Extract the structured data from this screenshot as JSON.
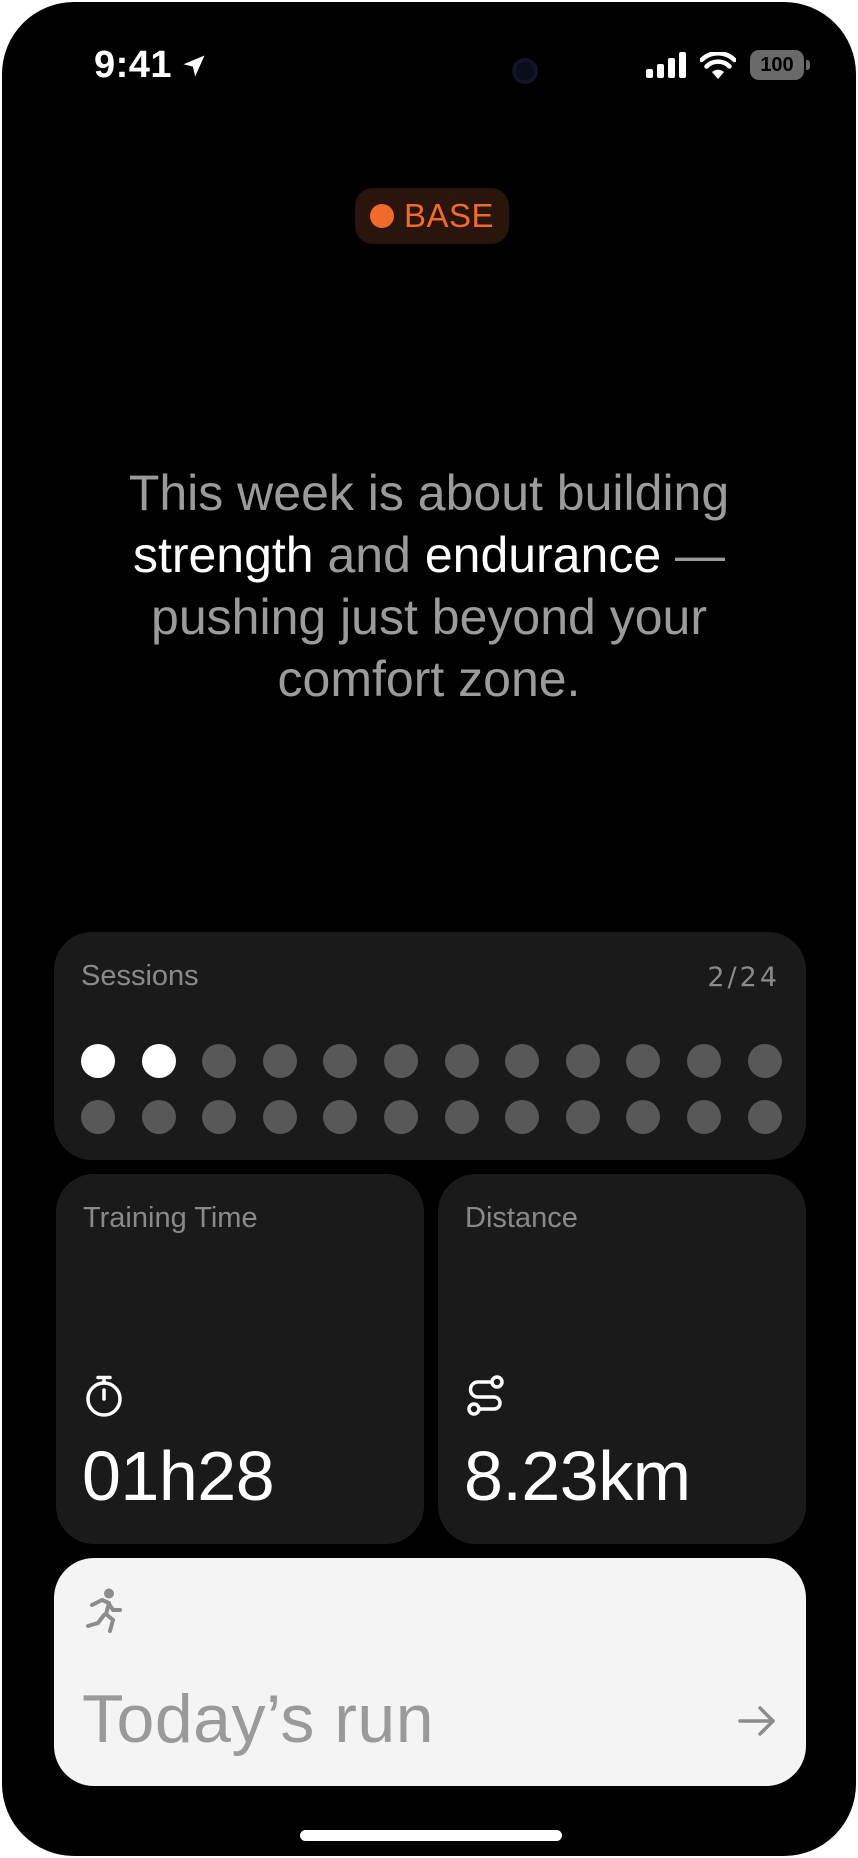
{
  "status_bar": {
    "time": "9:41",
    "battery": "100",
    "icons": [
      "location-arrow-icon",
      "signal-icon",
      "wifi-icon",
      "battery-icon"
    ]
  },
  "phase": {
    "label": "BASE",
    "color": "#f06a2b"
  },
  "headline": {
    "part1": "This week is about building ",
    "highlight1": "strength",
    "part2": " and ",
    "highlight2": "endurance",
    "part3": " —pushing just beyond your comfort zone."
  },
  "sessions": {
    "title": "Sessions",
    "count": "2/24",
    "completed": 2,
    "total": 24
  },
  "training_time": {
    "title": "Training Time",
    "value": "01h28",
    "icon": "stopwatch-icon"
  },
  "distance": {
    "title": "Distance",
    "value": "8.23km",
    "icon": "route-icon"
  },
  "todays_run": {
    "label": "Today’s run",
    "icon": "runner-icon",
    "arrow_icon": "arrow-right-icon"
  },
  "colors": {
    "background": "#000000",
    "card": "#1a1a1a",
    "accent": "#f06a2b",
    "button": "#f4f4f4"
  }
}
